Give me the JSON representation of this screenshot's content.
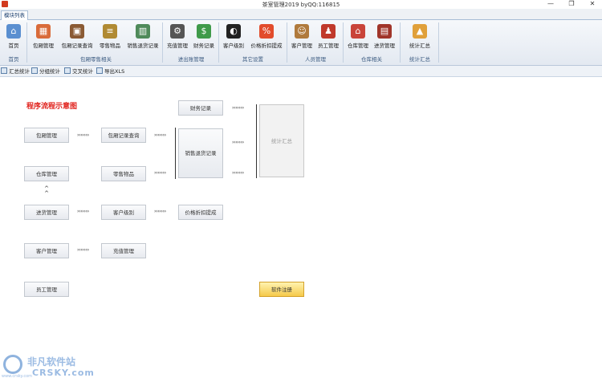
{
  "window": {
    "title": "茶室管理2019 byQQ:116815",
    "minimize": "—",
    "restore": "❐",
    "close": "✕"
  },
  "tabs": {
    "module_list": "模块列表"
  },
  "ribbon": {
    "buttons": [
      {
        "label": "首页",
        "icon": "home-icon",
        "color": "#5a8fd0"
      },
      {
        "label": "包厢管理",
        "icon": "room-icon",
        "color": "#d96b3a"
      },
      {
        "label": "包厢记录查询",
        "icon": "box-record-icon",
        "color": "#8a5a34"
      },
      {
        "label": "零售物品",
        "icon": "goods-icon",
        "color": "#b08a33"
      },
      {
        "label": "销售退货记录",
        "icon": "sales-return-icon",
        "color": "#4f8a5a"
      },
      {
        "label": "充值管理",
        "icon": "gear-icon",
        "color": "#555555"
      },
      {
        "label": "财务记录",
        "icon": "finance-icon",
        "color": "#3f9a4a"
      },
      {
        "label": "客户级别",
        "icon": "level-icon",
        "color": "#222222"
      },
      {
        "label": "价格折扣提成",
        "icon": "discount-icon",
        "color": "#e24c2c"
      },
      {
        "label": "客户管理",
        "icon": "customer-icon",
        "color": "#b07a3c"
      },
      {
        "label": "员工管理",
        "icon": "staff-icon",
        "color": "#c0392b"
      },
      {
        "label": "仓库管理",
        "icon": "warehouse-icon",
        "color": "#c9443a"
      },
      {
        "label": "进货管理",
        "icon": "purchase-icon",
        "color": "#a0352a"
      },
      {
        "label": "统计汇总",
        "icon": "stats-icon",
        "color": "#e0a03a"
      }
    ],
    "groups": [
      "首页",
      "包厢零售相关",
      "进出账管理",
      "其它设置",
      "人员管理",
      "仓库相关",
      "统计汇总"
    ]
  },
  "subtoolbar": [
    "汇总统计",
    "分组统计",
    "交叉统计",
    "导出XLS"
  ],
  "flow": {
    "title": "程序流程示意图",
    "boxes": {
      "room_mgmt": "包厢管理",
      "room_query": "包厢记录查询",
      "warehouse": "仓库管理",
      "retail": "零售物品",
      "purchase": "进货管理",
      "cust_level": "客户级别",
      "price_discount": "价格折扣提成",
      "customer": "客户管理",
      "recharge": "充值管理",
      "staff": "员工管理",
      "finance": "财务记录",
      "sales_return": "销售退货记录",
      "summary": "统计汇总",
      "register": "软件注册"
    },
    "arrow": "›››››››",
    "carets": "^\n^"
  },
  "watermark": {
    "brand": "非凡软件站",
    "domain": "CRSKY.com",
    "url": "www.crsky.com"
  }
}
